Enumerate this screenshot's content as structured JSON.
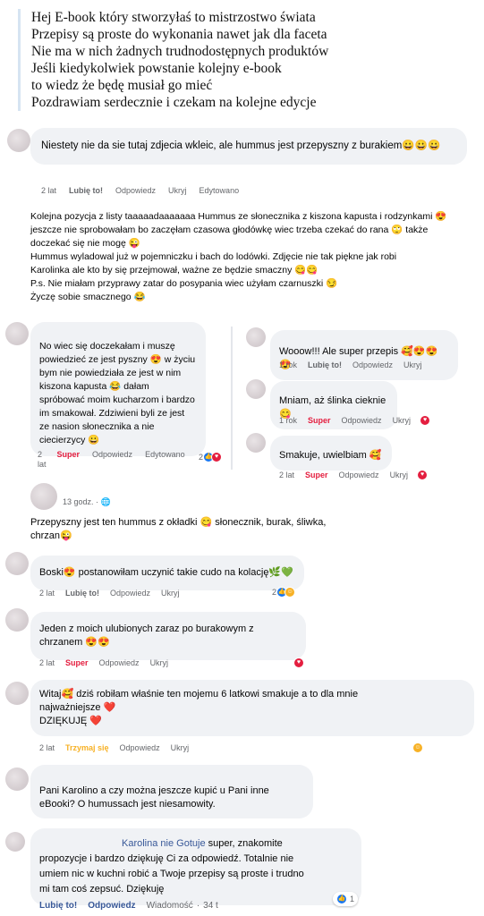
{
  "quote": {
    "lines": [
      "Hej E-book który stworzyłaś to mistrzostwo świata",
      "Przepisy są proste do wykonania nawet jak dla faceta",
      "Nie ma w nich żadnych trudnodostępnych produktów",
      "Jeśli kiedykolwiek powstanie kolejny e-book",
      "to wiedz że będę musiał go mieć",
      "Pozdrawiam serdecznie i czekam na kolejne edycje"
    ]
  },
  "c1": {
    "text": "Niestety nie da sie tutaj zdjecia wkleic, ale hummus jest przepyszny z burakiem😀😀😀",
    "time": "2 lat",
    "like": "Lubię to!",
    "reply": "Odpowiedz",
    "hide": "Ukryj",
    "edited": "Edytowano"
  },
  "post": {
    "l1": "Kolejna pozycja z listy taaaaadaaaaaaa Hummus ze słonecznika z kiszona kapusta i rodzynkami 😍",
    "l2": "jeszcze nie sprobowałam bo zaczęłam czasowa głodówkę wiec trzeba czekać do rana 🙄 także",
    "l3": "doczekać się nie mogę 😜",
    "l4": "Hummus wyladowal już w pojemniczku i bach do lodówki. Zdjęcie nie tak piękne jak robi",
    "l5": "Karolinka ale kto by się przejmował, ważne ze będzie smaczny 😋😋",
    "l6": "P.s. Nie miałam przyprawy zatar do posypania wiec użyłam czarnuszki 😏",
    "l7": "Życzę sobie smacznego 😂"
  },
  "c2": {
    "text": "No wiec się doczekałam i muszę powiedzieć ze jest pyszny 😍 w życiu bym nie powiedziała ze jest w nim kiszona kapusta 😂 dałam spróbować moim kucharzom i bardzo im smakował. Zdziwieni byli ze jest ze nasion słonecznika a nie ciecierzycy 😀",
    "time_a": "2",
    "time_b": "lat",
    "super": "Super",
    "reply": "Odpowiedz",
    "edited": "Edytowano",
    "count": "2"
  },
  "r1": {
    "text": "Wooow!!! Ale super przepis 🥰😍😍😍",
    "time": "1 rok",
    "like": "Lubię to!",
    "reply": "Odpowiedz",
    "hide": "Ukryj"
  },
  "r2": {
    "text": "Mniam, aż ślinka cieknie😋",
    "time": "1 rok",
    "super": "Super",
    "reply": "Odpowiedz",
    "hide": "Ukryj"
  },
  "r3": {
    "text": "Smakuje, uwielbiam 🥰",
    "time": "2 lat",
    "super": "Super",
    "reply": "Odpowiedz",
    "hide": "Ukryj"
  },
  "post2": {
    "time": "13 godz. ·",
    "l1": "Przepyszny jest ten hummus z okładki 😋 słonecznik, burak, śliwka,",
    "l2": "chrzan😜"
  },
  "c3": {
    "text": "Boski😍 postanowiłam uczynić takie cudo na kolację🌿💚",
    "time": "2 lat",
    "like": "Lubię to!",
    "reply": "Odpowiedz",
    "hide": "Ukryj",
    "count": "2"
  },
  "c4": {
    "text": "Jeden z moich ulubionych zaraz po burakowym z chrzanem 😍😍",
    "time": "2 lat",
    "super": "Super",
    "reply": "Odpowiedz",
    "hide": "Ukryj"
  },
  "c5": {
    "l1": "Witaj🥰 dziś robiłam właśnie ten mojemu 6 latkowi smakuje a to dla mnie",
    "l2": "najważniejsze ❤️",
    "l3": "DZIĘKUJĘ ❤️",
    "time": "2 lat",
    "hug": "Trzymaj się",
    "reply": "Odpowiedz",
    "hide": "Ukryj"
  },
  "c6": {
    "text": "Pani Karolino a czy można jeszcze kupić u Pani inne eBooki? O humussach jest niesamowity."
  },
  "c7": {
    "mention": "Karolina nie Gotuje",
    "text1": " super, znakomite",
    "l2": "propozycje i bardzo dziękuję Ci za odpowiedź. Totalnie nie",
    "l3": "umiem nic w kuchni robić a Twoje przepisy są proste i trudno",
    "l4": "mi tam coś zepsuć. Dziękuję",
    "like": "Lubię to!",
    "reply": "Odpowiedz",
    "msg": "Wiadomość",
    "time": "34 t",
    "count": "1"
  },
  "colors": {
    "accent": "#1877f2",
    "super": "#e41e3f",
    "hug": "#f7b125",
    "bubble": "#f0f2f5"
  }
}
